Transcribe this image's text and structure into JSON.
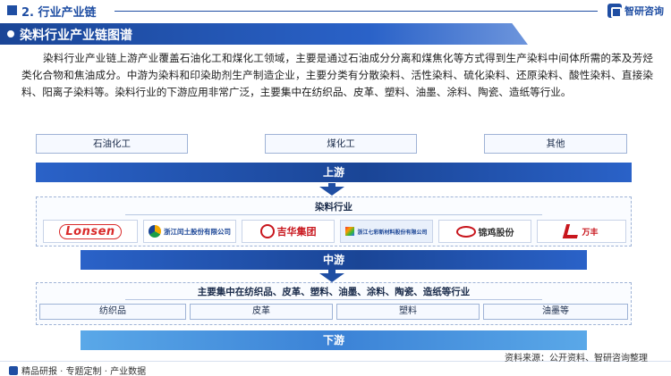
{
  "header": {
    "section_title": "2. 行业产业链",
    "brand_name": "智研咨询"
  },
  "banner": {
    "title": "染料行业产业链图谱"
  },
  "intro": "染料行业产业链上游产业覆盖石油化工和煤化工领域，主要是通过石油成分分离和煤焦化等方式得到生产染料中间体所需的苯及芳烃类化合物和焦油成分。中游为染料和印染助剂生产制造企业，主要分类有分散染料、活性染料、硫化染料、还原染料、酸性染料、直接染料、阳离子染料等。染料行业的下游应用非常广泛，主要集中在纺织品、皮革、塑料、油墨、涂料、陶瓷、造纸等行业。",
  "upstream": {
    "sources": [
      "石油化工",
      "煤化工",
      "其他"
    ],
    "label": "上游"
  },
  "midstream": {
    "section_title": "染料行业",
    "companies": [
      {
        "name": "Lonsen",
        "color": "#d92b2b"
      },
      {
        "name": "浙江闰土股份有限公司",
        "color": "#1a4596"
      },
      {
        "name": "吉华集团",
        "color": "#c8161d"
      },
      {
        "name": "浙江七彩新材料股份有限公司",
        "color": "#1a4596"
      },
      {
        "name": "锦鸡股份",
        "color": "#c8161d"
      },
      {
        "name": "万丰",
        "color": "#c8161d"
      }
    ],
    "label": "中游"
  },
  "downstream": {
    "section_title": "主要集中在纺织品、皮革、塑料、油墨、涂料、陶瓷、造纸等行业",
    "applications": [
      "纺织品",
      "皮革",
      "塑料",
      "油墨等"
    ],
    "label": "下游"
  },
  "footer": {
    "left": "精品研报 · 专题定制 · 产业数据",
    "source": "资料来源：公开资料、智研咨询整理"
  }
}
